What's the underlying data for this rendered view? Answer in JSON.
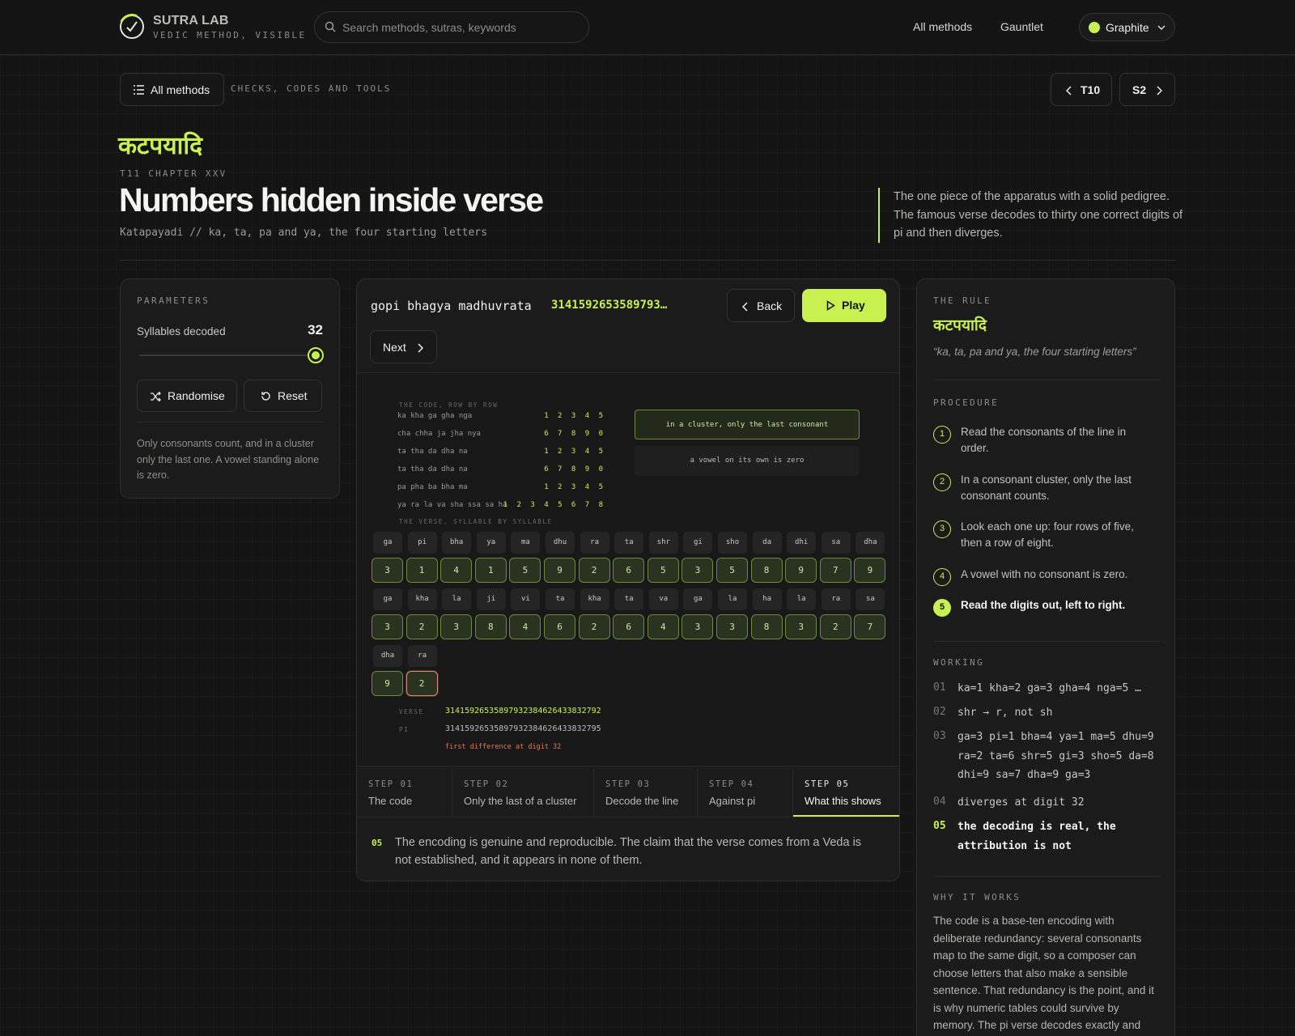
{
  "brand": {
    "name": "SUTRA LAB",
    "tagline": "VEDIC METHOD, VISIBLE"
  },
  "search": {
    "placeholder": "Search methods, sutras, keywords"
  },
  "nav": {
    "all_methods": "All methods",
    "gauntlet": "Gauntlet",
    "theme": "Graphite"
  },
  "breadcrumb": {
    "button": "All methods",
    "section": "CHECKS, CODES AND TOOLS",
    "prev": "T10",
    "next": "S2"
  },
  "header": {
    "sanskrit": "कटपयादि",
    "chapter": "T11 CHAPTER XXV",
    "title": "Numbers hidden inside verse",
    "subtitle": "Katapayadi // ka, ta, pa and ya, the four starting letters",
    "intro": "The one piece of the apparatus with a solid pedigree. The famous verse decodes to thirty one correct digits of pi and then diverges."
  },
  "params": {
    "heading": "PARAMETERS",
    "slider_label": "Syllables decoded",
    "slider_value": "32",
    "slider_fraction": 1.0,
    "randomise": "Randomise",
    "reset": "Reset",
    "note": "Only consonants count, and in a cluster only the last one. A vowel standing alone is zero."
  },
  "viz": {
    "verse_text": "gopi bhagya madhuvrata",
    "verse_digits": "3141592653589793…",
    "back": "Back",
    "play": "Play",
    "next": "Next",
    "code_heading": "THE CODE, ROW BY ROW",
    "code_rows": [
      {
        "letters": "ka kha ga gha nga",
        "digits": "1 2 3 4 5"
      },
      {
        "letters": "cha chha ja jha nya",
        "digits": "6 7 8 9 0"
      },
      {
        "letters": "ta tha da dha na",
        "digits": "1 2 3 4 5"
      },
      {
        "letters": "ta tha da dha na",
        "digits": "6 7 8 9 0"
      },
      {
        "letters": "pa pha ba bha ma",
        "digits": "1 2 3 4 5"
      },
      {
        "letters": "ya ra la va sha ssa sa ha",
        "digits": "1 2 3 4 5 6 7 8"
      }
    ],
    "rule_cluster": "in a cluster, only the last consonant",
    "rule_vowel": "a vowel on its own is zero",
    "syllable_heading": "THE VERSE, SYLLABLE BY SYLLABLE",
    "syllables": [
      "ga",
      "pi",
      "bha",
      "ya",
      "ma",
      "dhu",
      "ra",
      "ta",
      "shr",
      "gi",
      "sho",
      "da",
      "dhi",
      "sa",
      "dha",
      "ga",
      "kha",
      "la",
      "ji",
      "vi",
      "ta",
      "kha",
      "ta",
      "va",
      "ga",
      "la",
      "ha",
      "la",
      "ra",
      "sa",
      "dha",
      "ra"
    ],
    "digits": [
      "3",
      "1",
      "4",
      "1",
      "5",
      "9",
      "2",
      "6",
      "5",
      "3",
      "5",
      "8",
      "9",
      "7",
      "9",
      "3",
      "2",
      "3",
      "8",
      "4",
      "6",
      "2",
      "6",
      "4",
      "3",
      "3",
      "8",
      "3",
      "2",
      "7",
      "9",
      "2"
    ],
    "verse_label": "VERSE",
    "verse_full": "31415926535897932384626433832792",
    "pi_label": "PI",
    "pi_full": "31415926535897932384626433832795",
    "difference": "first difference at digit 32",
    "steps": [
      {
        "num": "STEP 01",
        "title": "The code"
      },
      {
        "num": "STEP 02",
        "title": "Only the last of a cluster"
      },
      {
        "num": "STEP 03",
        "title": "Decode the line"
      },
      {
        "num": "STEP 04",
        "title": "Against pi"
      },
      {
        "num": "STEP 05",
        "title": "What this shows"
      }
    ],
    "caption_num": "05",
    "caption": "The encoding is genuine and reproducible. The claim that the verse comes from a Veda is not established, and it appears in none of them."
  },
  "rule": {
    "heading": "THE RULE",
    "sanskrit": "कटपयादि",
    "quote": "“ka, ta, pa and ya, the four starting letters”",
    "procedure_heading": "PROCEDURE",
    "procedure": [
      {
        "n": "1",
        "text": "Read the consonants of the line in order."
      },
      {
        "n": "2",
        "text": "In a consonant cluster, only the last consonant counts."
      },
      {
        "n": "3",
        "text": "Look each one up: four rows of five, then a row of eight."
      },
      {
        "n": "4",
        "text": "A vowel with no consonant is zero."
      },
      {
        "n": "5",
        "text": "Read the digits out, left to right."
      }
    ],
    "working_heading": "WORKING",
    "working": [
      {
        "n": "01",
        "text": "ka=1 kha=2 ga=3 gha=4 nga=5 …"
      },
      {
        "n": "02",
        "text": "shr → r, not sh"
      },
      {
        "n": "03",
        "text": "ga=3 pi=1 bha=4 ya=1 ma=5 dhu=9 ra=2 ta=6 shr=5 gi=3 sho=5 da=8 dhi=9 sa=7 dha=9 ga=3"
      },
      {
        "n": "04",
        "text": "diverges at digit 32"
      },
      {
        "n": "05",
        "text": "the decoding is real, the attribution is not"
      }
    ],
    "why_heading": "WHY IT WORKS",
    "why": "The code is a base-ten encoding with deliberate redundancy: several consonants map to the same digit, so a composer can choose letters that also make a sensible sentence. That redundancy is the point, and it is why numeric tables could survive by memory. The pi verse decodes exactly and"
  },
  "colors": {
    "accent": "#c8f051",
    "background": "#141414",
    "panel": "#1b1b1b",
    "error": "#e07a5f"
  }
}
